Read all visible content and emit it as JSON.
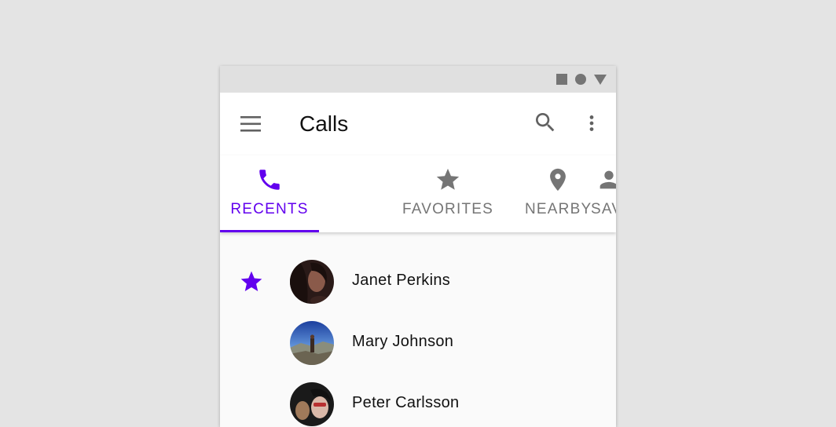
{
  "app": {
    "title": "Calls"
  },
  "toolbar": {
    "menu_icon": "menu-icon",
    "search_icon": "search-icon",
    "more_icon": "more-vert-icon"
  },
  "tabs": [
    {
      "label": "RECENTS",
      "icon": "phone-icon",
      "active": true
    },
    {
      "label": "FAVORITES",
      "icon": "star-icon",
      "active": false
    },
    {
      "label": "NEARBY",
      "icon": "location-pin-icon",
      "active": false
    },
    {
      "label": "SAV",
      "icon": "person-icon",
      "active": false
    }
  ],
  "contacts": [
    {
      "name": "Janet Perkins",
      "favorite": true,
      "avatar": "avatar-photo"
    },
    {
      "name": "Mary Johnson",
      "favorite": false,
      "avatar": "avatar-photo"
    },
    {
      "name": "Peter Carlsson",
      "favorite": false,
      "avatar": "avatar-photo"
    }
  ],
  "colors": {
    "accent": "#6200ee",
    "inactive": "#757575",
    "background": "#e4e4e4",
    "surface": "#ffffff"
  }
}
